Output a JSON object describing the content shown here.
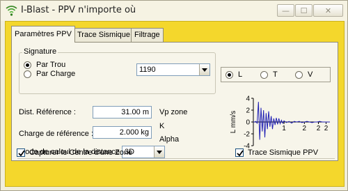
{
  "window": {
    "title": "I-Blast - PPV n'importe où",
    "min_glyph": "—",
    "max_glyph": "☐",
    "close_glyph": "✕"
  },
  "tabs": [
    {
      "label": "Paramètres PPV",
      "active": true
    },
    {
      "label": "Trace Sismique",
      "active": false
    },
    {
      "label": "Filtrage",
      "active": false
    }
  ],
  "signature": {
    "title": "Signature",
    "options": [
      {
        "label": "Par Trou",
        "checked": true
      },
      {
        "label": "Par Charge",
        "checked": false
      }
    ],
    "select_value": "1190"
  },
  "fields": {
    "dist_label": "Dist. Référence :",
    "dist_value": "31.00 m",
    "charge_label": "Charge de référence :",
    "charge_value": "2.000 kg",
    "mode_label": "Mode de calcul de la distance",
    "mode_value": "3D"
  },
  "zone_labels": {
    "vp": "Vp zone",
    "k": "K",
    "alpha": "Alpha"
  },
  "axis_radio": [
    {
      "label": "L",
      "checked": true
    },
    {
      "label": "T",
      "checked": false
    },
    {
      "label": "V",
      "checked": false
    }
  ],
  "checkboxes": {
    "capture_label": "Capturer le Centre d'une Zone",
    "capture_checked": true,
    "trace_label": "Trace Sismique  PPV",
    "trace_checked": true
  },
  "chart_data": {
    "type": "line",
    "title": "",
    "xlabel": "",
    "ylabel": "L mm/s",
    "ylim": [
      -4,
      4
    ],
    "yticks": [
      "4",
      "2",
      "0",
      "-2",
      "-4"
    ],
    "xticks": [
      "1",
      "2",
      "2",
      "2"
    ],
    "series": [
      {
        "x": [
          0.0,
          0.05,
          0.1,
          0.15,
          0.2,
          0.25,
          0.3,
          0.35,
          0.4,
          0.45,
          0.5,
          0.55,
          0.6,
          0.65,
          0.7,
          0.75,
          0.8,
          0.85,
          0.9,
          0.95,
          1.0,
          1.05,
          1.1,
          1.15,
          1.2,
          1.3,
          1.4,
          1.5,
          1.6,
          1.7,
          1.8,
          1.9,
          2.0,
          2.1,
          2.2,
          2.3,
          2.4,
          2.5,
          2.6,
          2.7,
          2.8,
          2.9,
          3.0
        ],
        "y": [
          0.0,
          0.0,
          0.1,
          -0.2,
          3.4,
          -3.0,
          2.4,
          -1.6,
          2.0,
          -2.6,
          1.5,
          -1.2,
          1.8,
          -0.8,
          1.0,
          -1.2,
          0.6,
          -0.5,
          0.7,
          -0.4,
          0.6,
          -0.3,
          0.3,
          -0.2,
          0.2,
          -0.1,
          0.1,
          -0.2,
          0.1,
          0.0,
          0.1,
          -0.1,
          0.0,
          0.1,
          0.0,
          -0.1,
          0.0,
          0.0,
          0.1,
          0.0,
          0.0,
          0.0,
          0.0
        ]
      }
    ]
  }
}
